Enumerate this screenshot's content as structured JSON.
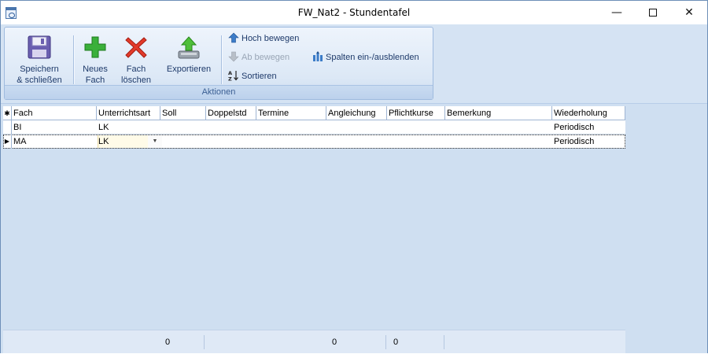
{
  "window": {
    "title": "FW_Nat2 - Stundentafel"
  },
  "ribbon": {
    "group_label": "Aktionen",
    "buttons": {
      "save": "Speichern\n& schließen",
      "new": "Neues\nFach",
      "delete": "Fach\nlöschen",
      "export": "Exportieren"
    },
    "small": {
      "up": "Hoch bewegen",
      "down": "Ab bewegen",
      "sort": "Sortieren",
      "columns": "Spalten ein-/ausblenden"
    }
  },
  "grid": {
    "columns": [
      "Fach",
      "Unterrichtsart",
      "Soll",
      "Doppelstd",
      "Termine",
      "Angleichung",
      "Pflichtkurse",
      "Bemerkung",
      "Wiederholung"
    ],
    "rows": [
      {
        "fach": "BI",
        "unterrichtsart": "LK",
        "wiederholung": "Periodisch"
      },
      {
        "fach": "MA",
        "unterrichtsart": "LK",
        "wiederholung": "Periodisch"
      }
    ],
    "footer": {
      "soll": "0",
      "angleichung": "0",
      "pflichtkurse": "0"
    }
  },
  "colors": {
    "accent": "#1e3a6a",
    "ribbon_bg": "#dce8f6",
    "grid_bg": "#cfdff1"
  }
}
